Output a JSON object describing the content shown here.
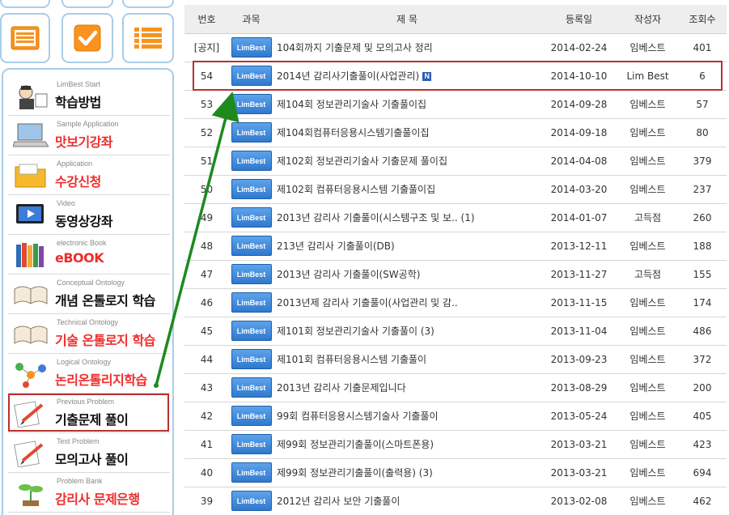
{
  "sidebar": {
    "top_icons": [
      "list-icon",
      "check-icon",
      "bullet-list-icon"
    ],
    "menu": [
      {
        "sub": "LimBest Start",
        "main": "학습방법",
        "color": "black",
        "icon": "teacher-icon"
      },
      {
        "sub": "Sample Application",
        "main": "맛보기강좌",
        "color": "red",
        "icon": "laptop-icon"
      },
      {
        "sub": "Application",
        "main": "수강신청",
        "color": "red",
        "icon": "folder-icon"
      },
      {
        "sub": "Video",
        "main": "동영상강좌",
        "color": "black",
        "icon": "video-icon"
      },
      {
        "sub": "electronic Book",
        "main": "eBOOK",
        "color": "red",
        "icon": "books-icon"
      },
      {
        "sub": "Conceptual Ontology",
        "main": "개념 온톨로지 학습",
        "color": "black",
        "icon": "open-book-icon"
      },
      {
        "sub": "Technical Ontology",
        "main": "기술 온톨로지 학습",
        "color": "red",
        "icon": "open-book-icon"
      },
      {
        "sub": "Logical Ontology",
        "main": "논리온톨리지학습",
        "color": "red",
        "icon": "network-icon"
      },
      {
        "sub": "Previous Problem",
        "main": "기출문제 풀이",
        "color": "black",
        "icon": "pencil-paper-icon"
      },
      {
        "sub": "Test Problem",
        "main": "모의고사 풀이",
        "color": "black",
        "icon": "pencil-paper-icon"
      },
      {
        "sub": "Problem Bank",
        "main": "감리사 문제은행",
        "color": "red",
        "icon": "plant-icon"
      }
    ]
  },
  "table": {
    "headers": [
      "번호",
      "과목",
      "제 목",
      "등록일",
      "작성자",
      "조회수"
    ],
    "badge_label": "LimBest",
    "new_badge": "N",
    "rows": [
      {
        "no": "[공지]",
        "title": "104회까지 기출문제 및 모의고사 정리",
        "date": "2014-02-24",
        "writer": "임베스트",
        "views": "401"
      },
      {
        "no": "54",
        "title": "2014년 감리사기출풀이(사업관리)",
        "date": "2014-10-10",
        "writer": "Lim Best",
        "views": "6",
        "new": true
      },
      {
        "no": "53",
        "title": "제104회 정보관리기술사 기출풀이집",
        "date": "2014-09-28",
        "writer": "임베스트",
        "views": "57"
      },
      {
        "no": "52",
        "title": "제104회컴퓨터응용시스템기출풀이집",
        "date": "2014-09-18",
        "writer": "임베스트",
        "views": "80"
      },
      {
        "no": "51",
        "title": "제102회 정보관리기술사 기출문제 풀이집",
        "date": "2014-04-08",
        "writer": "임베스트",
        "views": "379"
      },
      {
        "no": "50",
        "title": "제102회 컴퓨터응용시스템 기출풀이집",
        "date": "2014-03-20",
        "writer": "임베스트",
        "views": "237"
      },
      {
        "no": "49",
        "title": "2013년 감리사 기출풀이(시스템구조 및 보.. (1)",
        "date": "2014-01-07",
        "writer": "고득점",
        "views": "260"
      },
      {
        "no": "48",
        "title": "213년 감리사 기출풀이(DB)",
        "date": "2013-12-11",
        "writer": "임베스트",
        "views": "188"
      },
      {
        "no": "47",
        "title": "2013년 감리사 기출풀이(SW공학)",
        "date": "2013-11-27",
        "writer": "고득점",
        "views": "155"
      },
      {
        "no": "46",
        "title": "2013년제 감리사 기출풀이(사업관리 및 감..",
        "date": "2013-11-15",
        "writer": "임베스트",
        "views": "174"
      },
      {
        "no": "45",
        "title": "제101회 정보관리기술사 기출풀이 (3)",
        "date": "2013-11-04",
        "writer": "임베스트",
        "views": "486"
      },
      {
        "no": "44",
        "title": "제101회 컴퓨터응용시스템 기출풀이",
        "date": "2013-09-23",
        "writer": "임베스트",
        "views": "372"
      },
      {
        "no": "43",
        "title": "2013년 감리사 기출문제입니다",
        "date": "2013-08-29",
        "writer": "임베스트",
        "views": "200"
      },
      {
        "no": "42",
        "title": "99회 컴퓨터응용시스템기술사 기출풀이",
        "date": "2013-05-24",
        "writer": "임베스트",
        "views": "405"
      },
      {
        "no": "41",
        "title": "제99회 정보관리기출풀이(스마트폰용)",
        "date": "2013-03-21",
        "writer": "임베스트",
        "views": "423"
      },
      {
        "no": "40",
        "title": "제99회 정보관리기출풀이(출력용) (3)",
        "date": "2013-03-21",
        "writer": "임베스트",
        "views": "694"
      },
      {
        "no": "39",
        "title": "2012년 감리사 보안 기출풀이",
        "date": "2013-02-08",
        "writer": "임베스트",
        "views": "462"
      }
    ]
  },
  "colors": {
    "accent_red": "#ef2d2d",
    "highlight_border": "#b8312f",
    "arrow_green": "#1e8a1e",
    "badge_blue": "#2f79cf",
    "tile_border": "#a8cde9"
  }
}
